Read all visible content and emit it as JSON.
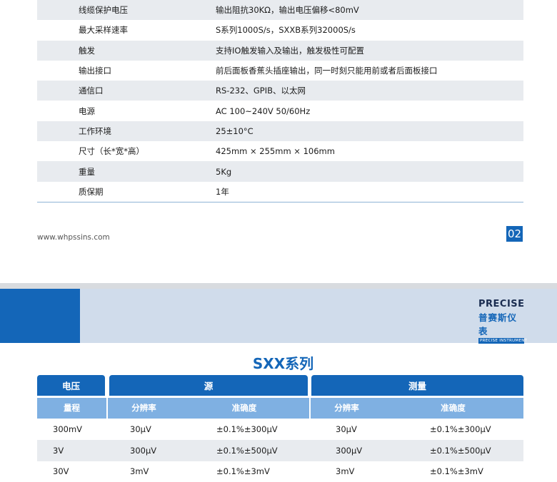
{
  "spec_rows": [
    {
      "label": "线缆保护电压",
      "value": "输出阻抗30KΩ，输出电压偏移<80mV"
    },
    {
      "label": "最大采样速率",
      "value": "S系列1000S/s，SXXB系列32000S/s"
    },
    {
      "label": "触发",
      "value": "支持IO触发输入及输出，触发极性可配置"
    },
    {
      "label": "输出接口",
      "value": "前后面板香蕉头插座输出，同一时刻只能用前或者后面板接口"
    },
    {
      "label": "通信口",
      "value": "RS-232、GPIB、以太网"
    },
    {
      "label": "电源",
      "value": "AC 100~240V 50/60Hz"
    },
    {
      "label": "工作环境",
      "value": "25±10°C"
    },
    {
      "label": "尺寸（长*宽*高）",
      "value": "425mm × 255mm × 106mm"
    },
    {
      "label": "重量",
      "value": "5Kg"
    },
    {
      "label": "质保期",
      "value": "1年"
    }
  ],
  "footer": {
    "website": "www.whpssins.com",
    "page_number": "02"
  },
  "brand": {
    "name_en": "PRECISE",
    "name_cn": "普赛斯仪表",
    "tagline": "PRECISE INSTRUMENT"
  },
  "series_title": "SXX系列",
  "table": {
    "group_headers": {
      "voltage": "电压",
      "source": "源",
      "measure": "测量"
    },
    "columns": {
      "range": "量程",
      "source_resolution": "分辨率",
      "source_accuracy": "准确度",
      "measure_resolution": "分辨率",
      "measure_accuracy": "准确度"
    },
    "rows": [
      {
        "range": "300mV",
        "src_res": "30μV",
        "src_acc": "±0.1%±300μV",
        "meas_res": "30μV",
        "meas_acc": "±0.1%±300μV"
      },
      {
        "range": "3V",
        "src_res": "300μV",
        "src_acc": "±0.1%±500μV",
        "meas_res": "300μV",
        "meas_acc": "±0.1%±500μV"
      },
      {
        "range": "30V",
        "src_res": "3mV",
        "src_acc": "±0.1%±3mV",
        "meas_res": "3mV",
        "meas_acc": "±0.1%±3mV"
      }
    ]
  },
  "colors": {
    "brand_blue": "#1466b8",
    "light_blue": "#7fb0e2",
    "band": "#d0dceb",
    "row_shade": "#e8ebef"
  }
}
